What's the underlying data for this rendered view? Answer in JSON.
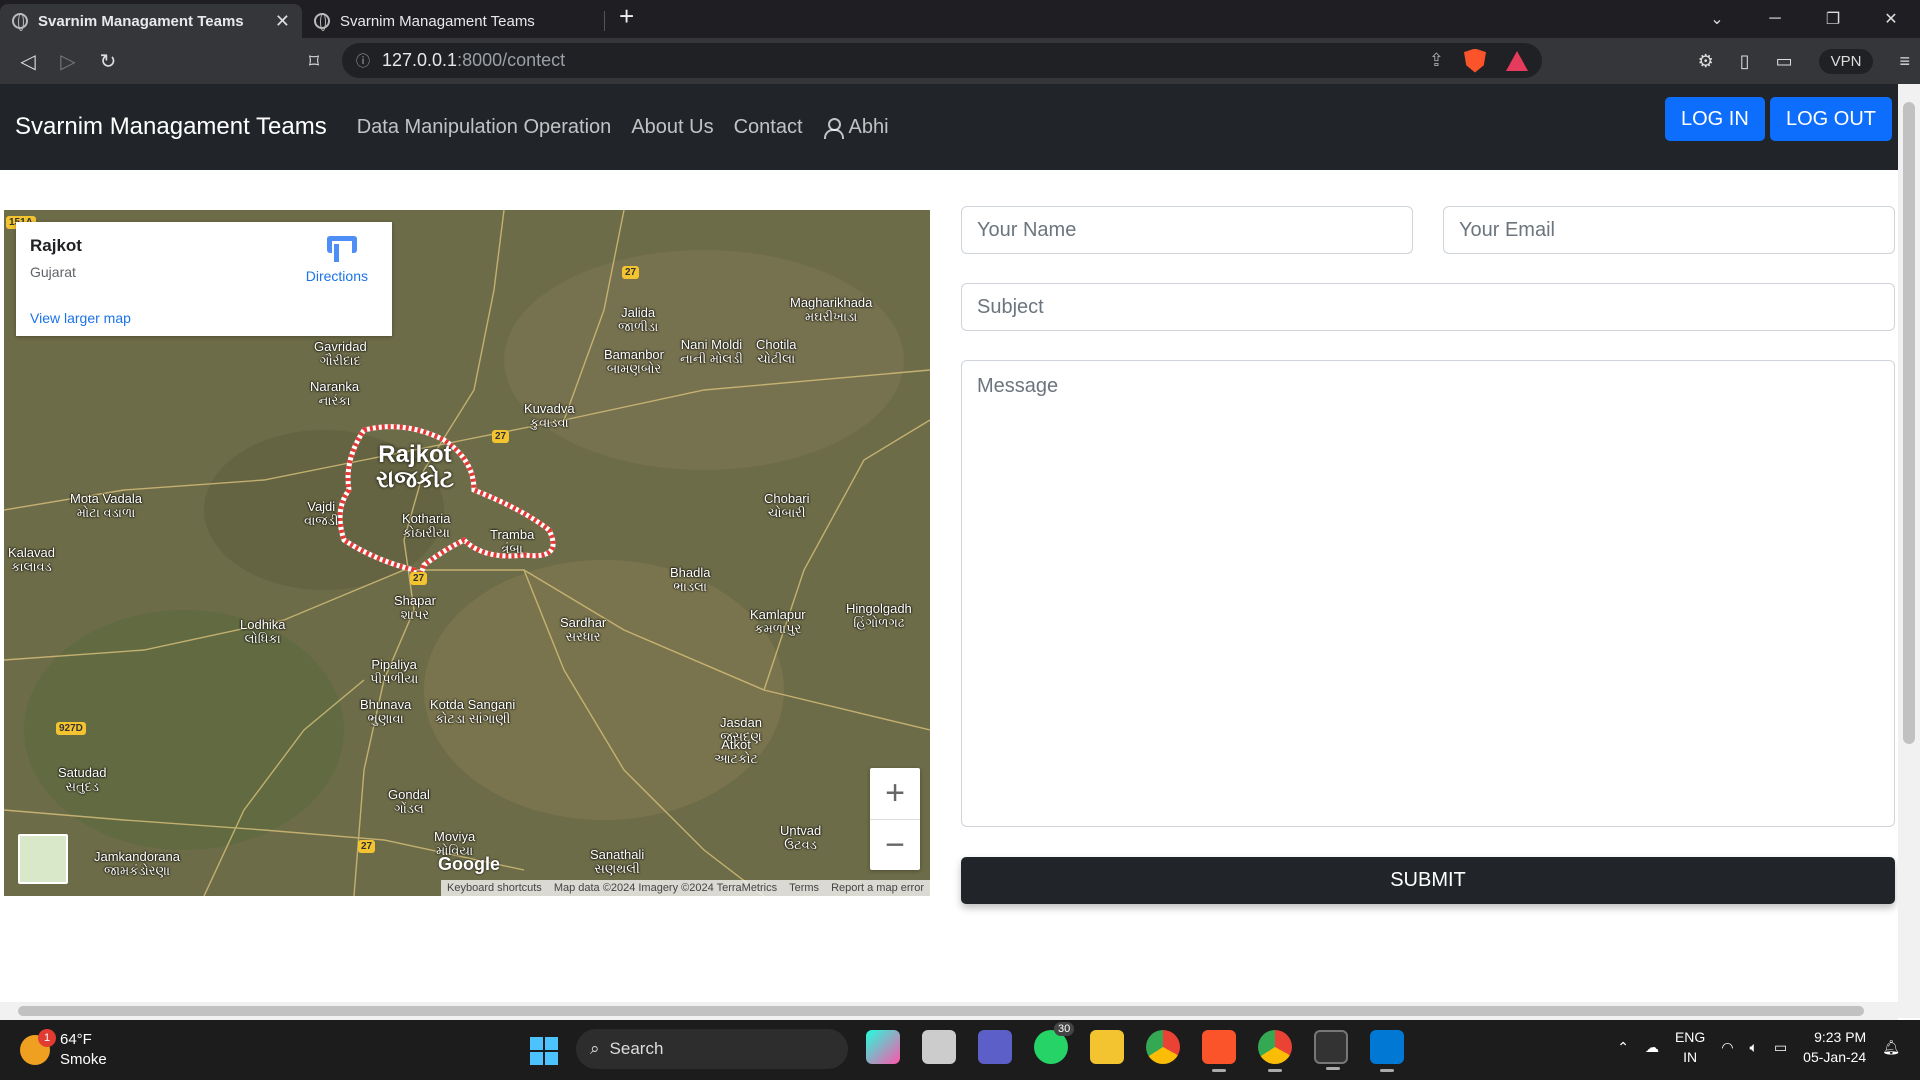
{
  "browser": {
    "tabs": [
      {
        "title": "Svarnim Managament Teams",
        "active": true
      },
      {
        "title": "Svarnim Managament Teams",
        "active": false
      }
    ],
    "url_host": "127.0.0.1",
    "url_path": ":8000/contect",
    "vpn_label": "VPN"
  },
  "navbar": {
    "brand": "Svarnim Managament Teams",
    "links": [
      "Data Manipulation Operation",
      "About Us",
      "Contact"
    ],
    "user": "Abhi",
    "login": "LOG IN",
    "logout": "LOG OUT"
  },
  "map": {
    "place": "Rajkot",
    "region": "Gujarat",
    "directions": "Directions",
    "view_larger": "View larger map",
    "city_label": "Rajkot",
    "city_label_local": "રાજકોટ",
    "towns": [
      {
        "name": "Gavridad",
        "local": "ગૌરીદાદ"
      },
      {
        "name": "Naranka",
        "local": "નારંકા"
      },
      {
        "name": "Kuvadva",
        "local": "કુવાડવા"
      },
      {
        "name": "Jalida",
        "local": "જાળીડા"
      },
      {
        "name": "Bamanbor",
        "local": "બામણબોર"
      },
      {
        "name": "Nani Moldi",
        "local": "નાની મોલડી"
      },
      {
        "name": "Chotila",
        "local": "ચોટીલા"
      },
      {
        "name": "Magharikhada",
        "local": "મઘરીખાડા"
      },
      {
        "name": "Mota Vadala",
        "local": "મોટા વડાળા"
      },
      {
        "name": "Vajdi",
        "local": "વાજડી"
      },
      {
        "name": "Kotharia",
        "local": "કોઠારીયા"
      },
      {
        "name": "Tramba",
        "local": "ત્રંબા"
      },
      {
        "name": "Chobari",
        "local": "ચોબારી"
      },
      {
        "name": "Kalavad",
        "local": "કાલાવડ"
      },
      {
        "name": "Shapar",
        "local": "શાપર"
      },
      {
        "name": "Bhadla",
        "local": "ભાડલા"
      },
      {
        "name": "Sardhar",
        "local": "સરધાર"
      },
      {
        "name": "Kamlapur",
        "local": "કમળાપુર"
      },
      {
        "name": "Hingolgadh",
        "local": "હિંગોળગઢ"
      },
      {
        "name": "Lodhika",
        "local": "લોધિકા"
      },
      {
        "name": "Pipaliya",
        "local": "પીપળીયા"
      },
      {
        "name": "Bhunava",
        "local": "ભુણાવા"
      },
      {
        "name": "Kotda Sangani",
        "local": "કોટડા સાંગાણી"
      },
      {
        "name": "Jasdan",
        "local": "જસદણ"
      },
      {
        "name": "Satudad",
        "local": "સતુદડ"
      },
      {
        "name": "Atkot",
        "local": "આટકોટ"
      },
      {
        "name": "Gondal",
        "local": "ગોંડલ"
      },
      {
        "name": "Untvad",
        "local": "ઉંટવડ"
      },
      {
        "name": "Jamkandorana",
        "local": "જામકંડોરણા"
      },
      {
        "name": "Moviya",
        "local": "મોવિયા"
      },
      {
        "name": "Sanathali",
        "local": "સણથલી"
      }
    ],
    "shields": [
      "27",
      "27",
      "27",
      "27",
      "927D",
      "151A"
    ],
    "google": "Google",
    "footer": [
      "Keyboard shortcuts",
      "Map data ©2024 Imagery ©2024 TerraMetrics",
      "Terms",
      "Report a map error"
    ]
  },
  "form": {
    "name_placeholder": "Your Name",
    "email_placeholder": "Your Email",
    "subject_placeholder": "Subject",
    "message_placeholder": "Message",
    "submit": "SUBMIT"
  },
  "taskbar": {
    "temp": "64°F",
    "condition": "Smoke",
    "weather_badge": "1",
    "search": "Search",
    "whatsapp_badge": "30",
    "lang1": "ENG",
    "lang2": "IN",
    "time": "9:23 PM",
    "date": "05-Jan-24"
  }
}
